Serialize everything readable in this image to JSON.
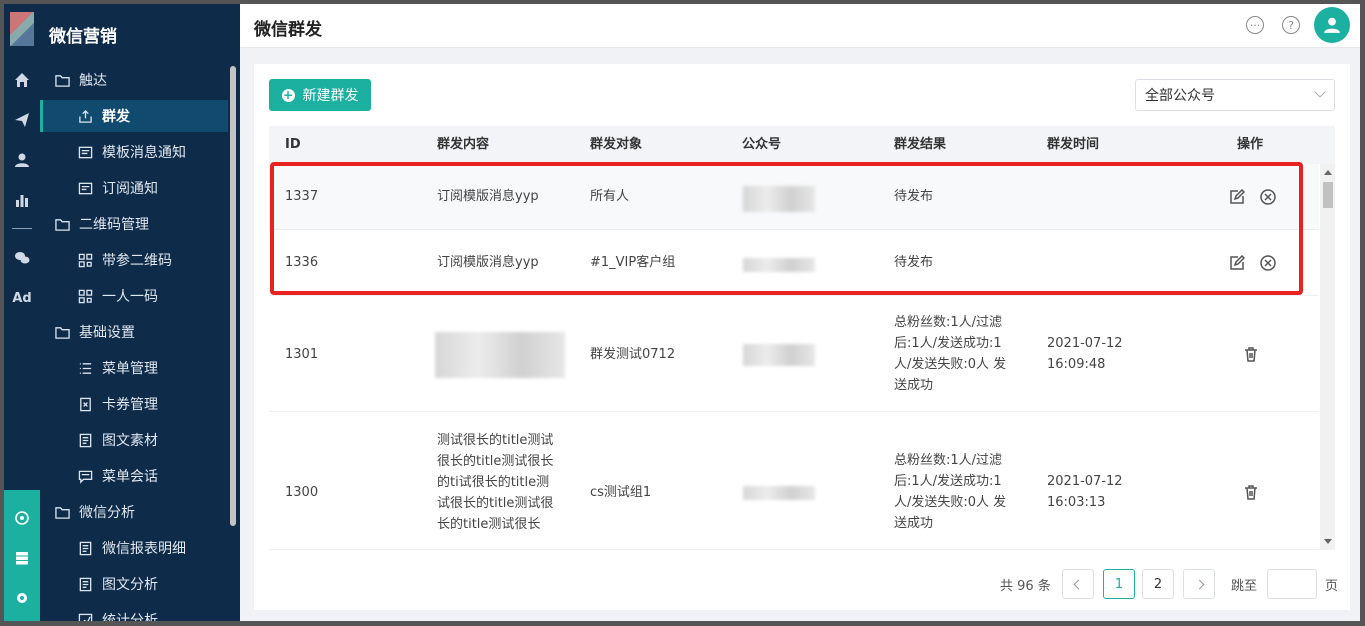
{
  "app": {
    "title": "微信营销"
  },
  "header": {
    "page_title": "微信群发"
  },
  "sidebar": {
    "items": [
      {
        "label": "触达",
        "level": 1,
        "icon": "folder-icon"
      },
      {
        "label": "群发",
        "level": 2,
        "icon": "share-icon",
        "active": true
      },
      {
        "label": "模板消息通知",
        "level": 2,
        "icon": "template-icon"
      },
      {
        "label": "订阅通知",
        "level": 2,
        "icon": "message-icon"
      },
      {
        "label": "二维码管理",
        "level": 1,
        "icon": "folder-icon"
      },
      {
        "label": "带参二维码",
        "level": 2,
        "icon": "qrcode-icon"
      },
      {
        "label": "一人一码",
        "level": 2,
        "icon": "qrcode-icon"
      },
      {
        "label": "基础设置",
        "level": 1,
        "icon": "folder-icon"
      },
      {
        "label": "菜单管理",
        "level": 2,
        "icon": "list-icon"
      },
      {
        "label": "卡券管理",
        "level": 2,
        "icon": "coupon-icon"
      },
      {
        "label": "图文素材",
        "level": 2,
        "icon": "doc-icon"
      },
      {
        "label": "菜单会话",
        "level": 2,
        "icon": "chat-icon"
      },
      {
        "label": "微信分析",
        "level": 1,
        "icon": "folder-icon"
      },
      {
        "label": "微信报表明细",
        "level": 2,
        "icon": "doc-icon"
      },
      {
        "label": "图文分析",
        "level": 2,
        "icon": "doc-icon"
      },
      {
        "label": "统计分析",
        "level": 2,
        "icon": "chart-icon"
      }
    ]
  },
  "rail": {
    "ad_label": "Ad"
  },
  "toolbar": {
    "new_button": "新建群发",
    "account_select": "全部公众号"
  },
  "table": {
    "columns": [
      "ID",
      "群发内容",
      "群发对象",
      "公众号",
      "群发结果",
      "群发时间",
      "操作"
    ],
    "rows": [
      {
        "id": "1337",
        "content": "订阅模版消息yyp",
        "target": "所有人",
        "result": "待发布",
        "time": "",
        "actions": [
          "edit",
          "cancel"
        ]
      },
      {
        "id": "1336",
        "content": "订阅模版消息yyp",
        "target": "#1_VIP客户组",
        "result": "待发布",
        "time": "",
        "actions": [
          "edit",
          "cancel"
        ]
      },
      {
        "id": "1301",
        "content": "",
        "target": "群发测试0712",
        "result": "总粉丝数:1人/过滤后:1人/发送成功:1人/发送失败:0人 发送成功",
        "time": "2021-07-12 16:09:48",
        "actions": [
          "delete"
        ]
      },
      {
        "id": "1300",
        "content": "测试很长的title测试很长的title测试很长的ti试很长的title测试很长的title测试很长的title测试很长",
        "target": "cs测试组1",
        "result": "总粉丝数:1人/过滤后:1人/发送成功:1人/发送失败:0人 发送成功",
        "time": "2021-07-12 16:03:13",
        "actions": [
          "delete"
        ]
      }
    ]
  },
  "pagination": {
    "total_text": "共 96 条",
    "pages": [
      "1",
      "2"
    ],
    "current": "1",
    "jump_label": "跳至",
    "page_unit": "页"
  },
  "colors": {
    "accent": "#1bb0a0",
    "sidebar_bg": "#0f2b4a",
    "highlight": "#e8231f"
  }
}
